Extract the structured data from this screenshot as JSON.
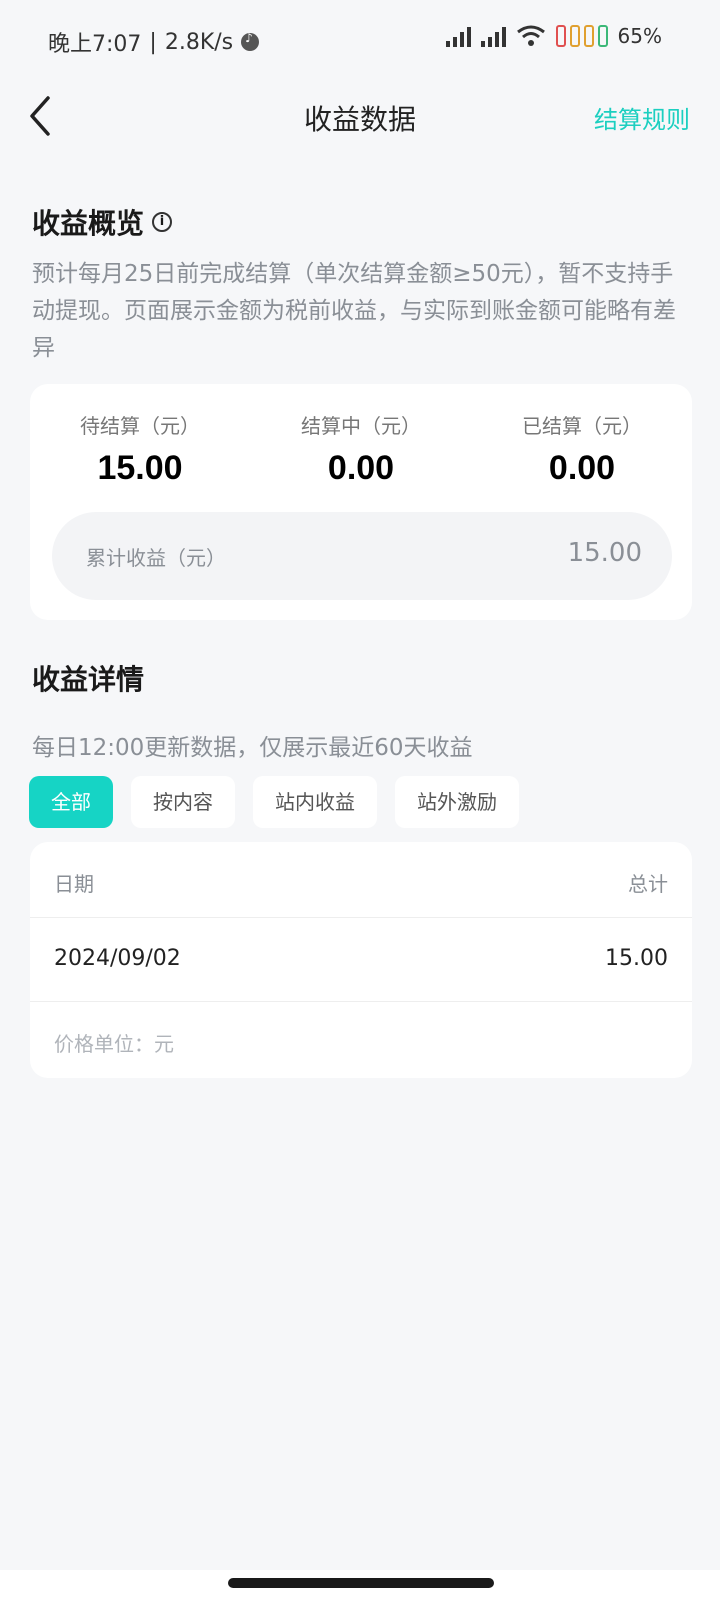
{
  "status_bar": {
    "time": "晚上7:07",
    "speed": "2.8K/s",
    "battery_percent": "65%"
  },
  "header": {
    "title": "收益数据",
    "rules_link": "结算规则",
    "back_icon": "chevron-left-icon"
  },
  "overview": {
    "title": "收益概览",
    "info_icon": "i",
    "description": "预计每月25日前完成结算（单次结算金额≥50元），暂不支持手动提现。页面展示金额为税前收益，与实际到账金额可能略有差异",
    "stats": [
      {
        "label": "待结算（元）",
        "value": "15.00"
      },
      {
        "label": "结算中（元）",
        "value": "0.00"
      },
      {
        "label": "已结算（元）",
        "value": "0.00"
      }
    ],
    "cumulative_label": "累计收益（元）",
    "cumulative_value": "15.00"
  },
  "details": {
    "title": "收益详情",
    "description": "每日12:00更新数据，仅展示最近60天收益",
    "filters": [
      "全部",
      "按内容",
      "站内收益",
      "站外激励"
    ],
    "active_filter": "全部",
    "columns": {
      "date": "日期",
      "total": "总计"
    },
    "rows": [
      {
        "date": "2024/09/02",
        "total": "15.00"
      }
    ],
    "unit_note": "价格单位：元"
  },
  "colors": {
    "accent": "#16d4c5",
    "background": "#f6f7f9"
  }
}
